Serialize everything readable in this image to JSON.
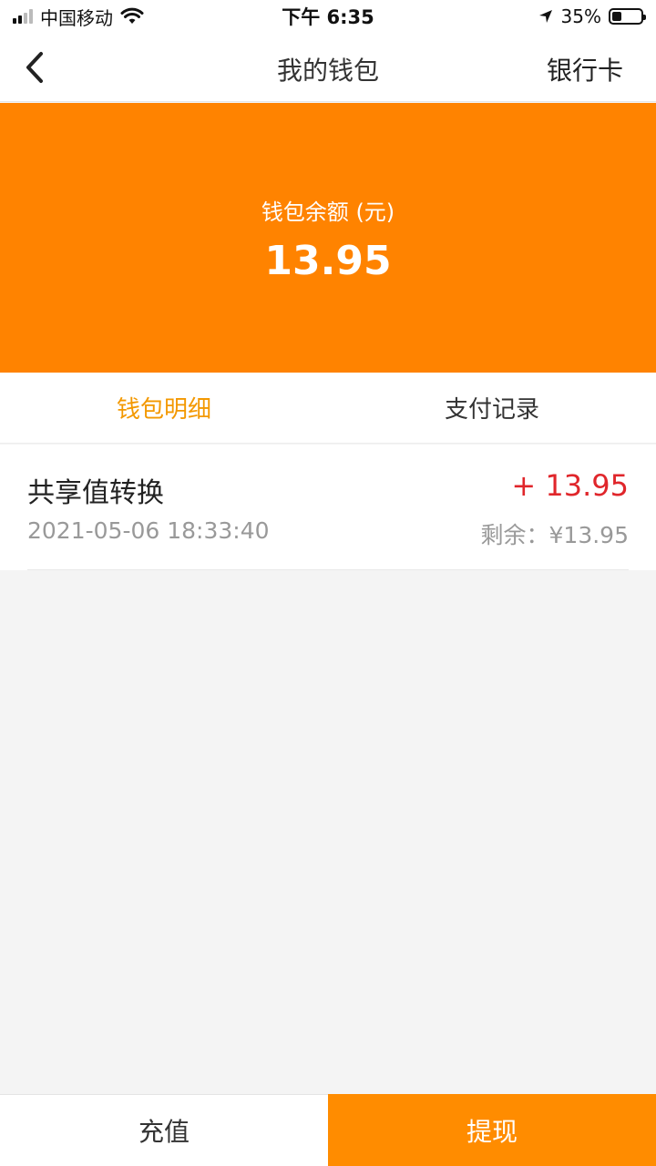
{
  "status_bar": {
    "carrier": "中国移动",
    "time": "下午 6:35",
    "battery_percent_text": "35%",
    "battery_level": 0.35
  },
  "nav": {
    "title": "我的钱包",
    "right_action": "银行卡"
  },
  "balance": {
    "label": "钱包余额 (元)",
    "amount": "13.95"
  },
  "tabs": [
    {
      "label": "钱包明细",
      "active": true
    },
    {
      "label": "支付记录",
      "active": false
    }
  ],
  "records": [
    {
      "title": "共享值转换",
      "amount": "+ 13.95",
      "time": "2021-05-06 18:33:40",
      "remain": "剩余：¥13.95"
    }
  ],
  "bottom": {
    "recharge_label": "充值",
    "withdraw_label": "提现"
  },
  "colors": {
    "brand_orange": "#ff8300",
    "tab_active": "#f39800",
    "amount_positive": "#e0262b"
  }
}
